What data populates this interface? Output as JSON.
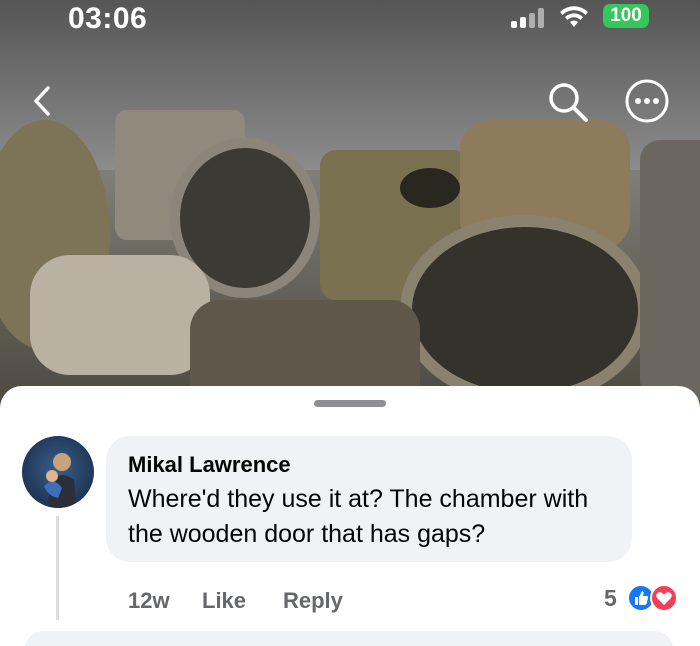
{
  "status_bar": {
    "time": "03:06",
    "battery": "100"
  },
  "photo": {
    "icons": [
      "back-icon",
      "search-icon",
      "more-icon"
    ]
  },
  "comment": {
    "author": "Mikal Lawrence",
    "text": "Where'd they use it at? The chamber with the wooden door that has gaps?",
    "time_ago": "12w",
    "like_label": "Like",
    "reply_label": "Reply",
    "reaction_count": "5",
    "reactions": [
      "like-reaction-icon",
      "love-reaction-icon"
    ]
  },
  "colors": {
    "accent_blue": "#1877f2",
    "love_red": "#f33e58",
    "battery_green": "#34c759",
    "bubble_bg": "#f0f2f5",
    "meta_gray": "#65676b"
  }
}
